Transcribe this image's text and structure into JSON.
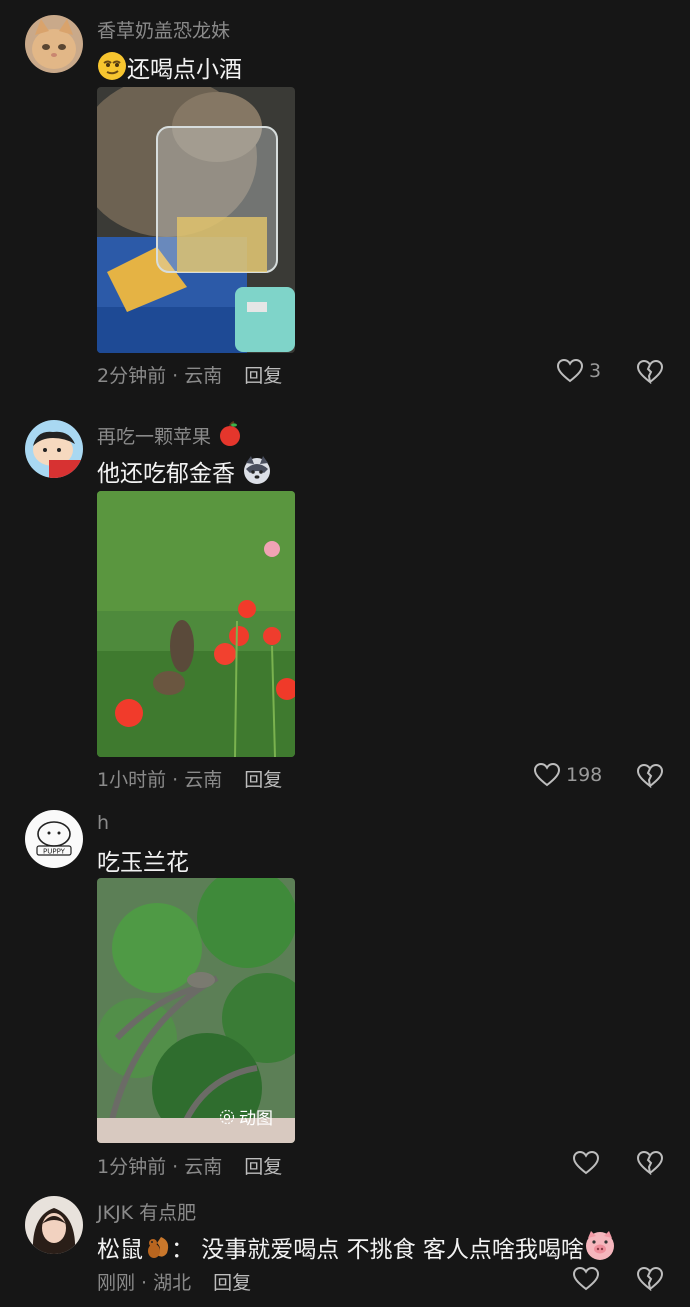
{
  "comments": [
    {
      "username": "香草奶盖恐龙妹",
      "text": "还喝点小酒",
      "time_location": "2分钟前 · 云南",
      "reply_label": "回复",
      "likes": "3",
      "avatar_icon": "orange-cat-avatar",
      "photo": "squirrel drinking from glass"
    },
    {
      "username": "再吃一颗苹果",
      "text": "他还吃郁金香",
      "time_location": "1小时前 · 云南",
      "reply_label": "回复",
      "likes": "198",
      "avatar_icon": "cartoon-boy-avatar",
      "photo": "squirrel in grass with red flowers"
    },
    {
      "username": "h",
      "text": "吃玉兰花",
      "time_location": "1分钟前 · 云南",
      "reply_label": "回复",
      "likes": "",
      "avatar_icon": "puppy-sketch-avatar",
      "photo": "squirrel in magnolia tree",
      "photo_badge": "动图"
    },
    {
      "username": "JKJK 有点肥",
      "text_prefix": "松鼠",
      "text_main": "： 没事就爱喝点 不挑食 客人点啥我喝啥",
      "time_location": "刚刚 · 湖北",
      "reply_label": "回复",
      "likes": "",
      "avatar_icon": "girl-photo-avatar"
    }
  ],
  "colors": {
    "background": "#161616",
    "muted_text": "#8a8a8a",
    "primary_text": "#f2f2f2"
  }
}
